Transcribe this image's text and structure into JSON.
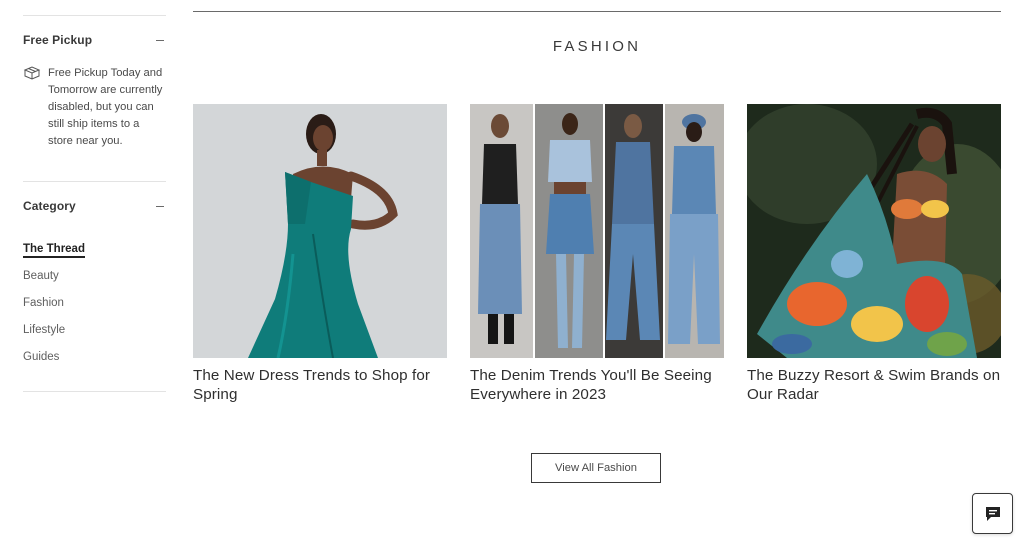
{
  "sidebar": {
    "free_pickup": {
      "title": "Free Pickup",
      "message": "Free Pickup Today and Tomorrow are currently disabled, but you can still ship items to a store near you."
    },
    "category": {
      "title": "Category",
      "items": [
        {
          "label": "The Thread",
          "active": true
        },
        {
          "label": "Beauty",
          "active": false
        },
        {
          "label": "Fashion",
          "active": false
        },
        {
          "label": "Lifestyle",
          "active": false
        },
        {
          "label": "Guides",
          "active": false
        }
      ]
    }
  },
  "main": {
    "heading": "FASHION",
    "cards": [
      {
        "title": "The New Dress Trends to Shop for Spring"
      },
      {
        "title": "The Denim Trends You'll Be Seeing Everywhere in 2023"
      },
      {
        "title": "The Buzzy Resort & Swim Brands on Our Radar"
      }
    ],
    "view_all_label": "View All Fashion"
  },
  "chat": {
    "icon": "chat-icon"
  },
  "colors": {
    "text": "#393939",
    "divider": "#e3e3e3",
    "teal_dress": "#0f7c7a",
    "denim": "#5b87b5"
  }
}
